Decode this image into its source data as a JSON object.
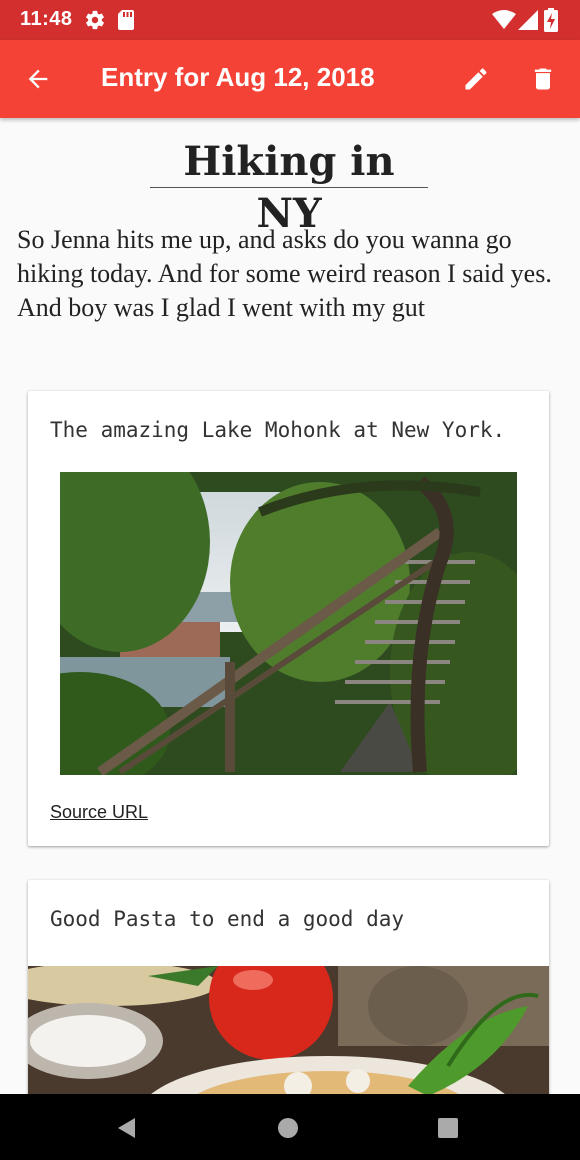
{
  "status_bar": {
    "time": "11:48",
    "icons": [
      "settings-gear-icon",
      "sd-card-icon",
      "wifi-icon",
      "cellular-signal-icon",
      "battery-charging-icon"
    ]
  },
  "app_bar": {
    "title": "Entry for Aug 12, 2018",
    "back_icon": "arrow-back-icon",
    "edit_icon": "pencil-edit-icon",
    "delete_icon": "trash-delete-icon"
  },
  "entry": {
    "title": "Hiking in NY",
    "body": "So Jenna hits me up, and asks do you wanna go hiking today. And for some weird reason I said yes. And boy was I glad I went with my gut"
  },
  "cards": [
    {
      "caption": "The amazing Lake Mohonk at New York.",
      "image": "photo of wooden staircase along a forested cliff overlooking Lake Mohonk",
      "link_label": "Source URL"
    },
    {
      "caption": "Good Pasta to end a good day",
      "image": "photo of a plate of pasta with tomatoes, basil and grated cheese"
    }
  ],
  "nav_bar": {
    "icons": [
      "back-triangle-icon",
      "home-circle-icon",
      "recents-square-icon"
    ]
  },
  "colors": {
    "status_bar": "#d32f2f",
    "app_bar": "#f44336",
    "background": "#fafafa",
    "nav_bar": "#000000"
  }
}
